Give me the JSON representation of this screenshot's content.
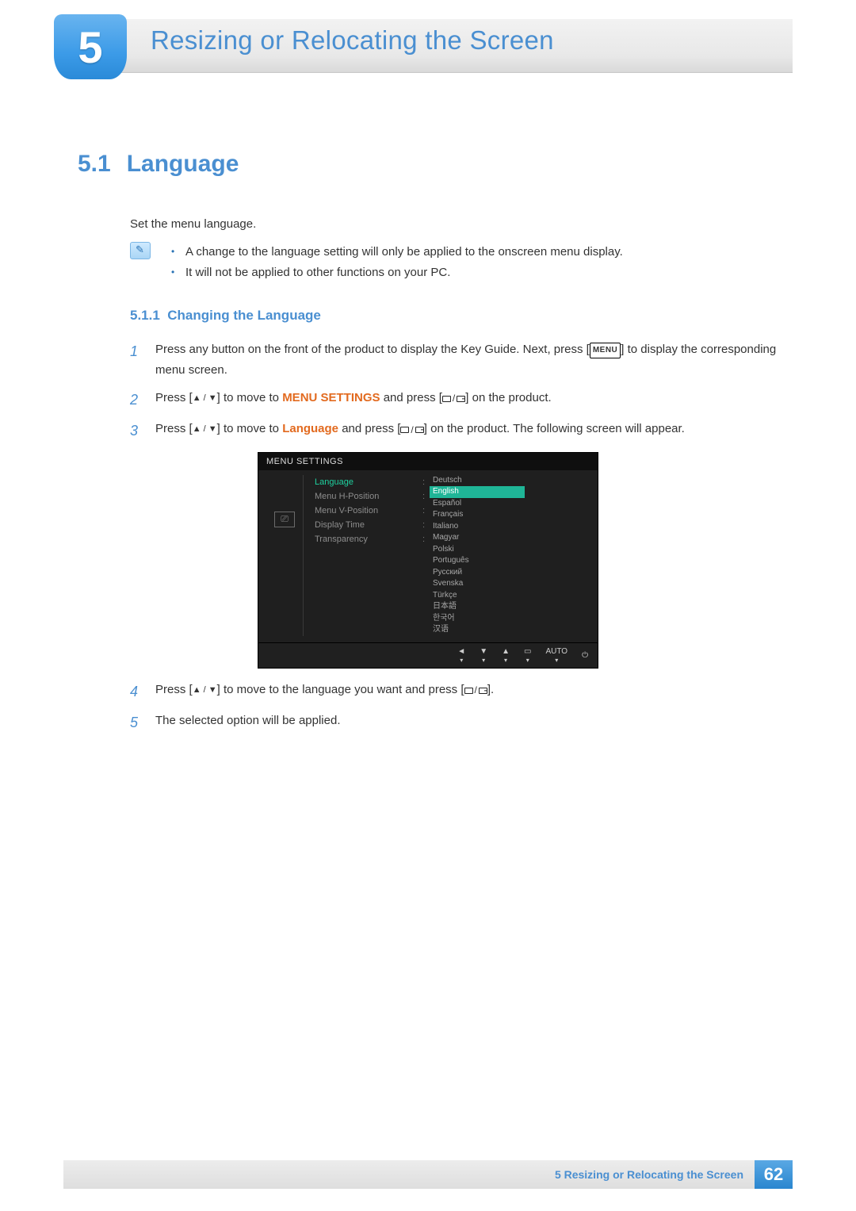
{
  "chapter": {
    "number": "5",
    "title": "Resizing or Relocating the Screen"
  },
  "section": {
    "number": "5.1",
    "title": "Language",
    "intro": "Set the menu language.",
    "notes": [
      "A change to the language setting will only be applied to the onscreen menu display.",
      "It will not be applied to other functions on your PC."
    ]
  },
  "subsection": {
    "number": "5.1.1",
    "title": "Changing the Language"
  },
  "steps": {
    "s1_a": "Press any button on the front of the product to display the Key Guide. Next, press [",
    "s1_menu": "MENU",
    "s1_b": "] to display the corresponding menu screen.",
    "s2_a": "Press [",
    "s2_b": "] to move to ",
    "s2_menu_settings": "MENU SETTINGS",
    "s2_c": " and press [",
    "s2_d": "] on the product.",
    "s3_a": "Press [",
    "s3_b": "] to move to ",
    "s3_language": "Language",
    "s3_c": " and press [",
    "s3_d": "] on the product. The following screen will appear.",
    "s4_a": "Press [",
    "s4_b": "] to move to the language you want and press [",
    "s4_c": "].",
    "s5": "The selected option will be applied."
  },
  "osd": {
    "title": "MENU SETTINGS",
    "menu_items": [
      {
        "label": "Language",
        "selected": true
      },
      {
        "label": "Menu H-Position",
        "selected": false
      },
      {
        "label": "Menu V-Position",
        "selected": false
      },
      {
        "label": "Display Time",
        "selected": false
      },
      {
        "label": "Transparency",
        "selected": false
      }
    ],
    "languages": [
      "Deutsch",
      "English",
      "Español",
      "Français",
      "Italiano",
      "Magyar",
      "Polski",
      "Português",
      "Русский",
      "Svenska",
      "Türkçe",
      "日本語",
      "한국어",
      "汉语"
    ],
    "active_language_index": 1,
    "bottom_auto": "AUTO"
  },
  "footer": {
    "title": "5  Resizing or Relocating the Screen",
    "page": "62"
  }
}
